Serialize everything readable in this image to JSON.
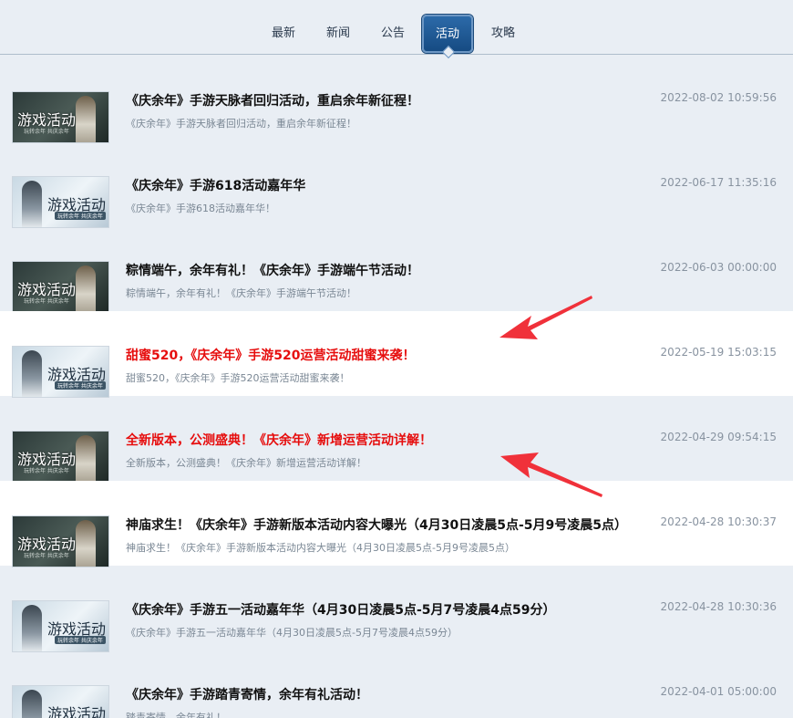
{
  "tabs": [
    {
      "label": "最新"
    },
    {
      "label": "新闻"
    },
    {
      "label": "公告"
    },
    {
      "label": "活动"
    },
    {
      "label": "攻略"
    }
  ],
  "active_tab": "活动",
  "thumbnail": {
    "title": "游戏活动",
    "subtitle": "玩转余年 共庆余年"
  },
  "articles": [
    {
      "title": "《庆余年》手游天脉者回归活动，重启余年新征程！",
      "summary": "《庆余年》手游天脉者回归活动，重启余年新征程！",
      "date": "2022-08-02 10:59:56",
      "highlight": false
    },
    {
      "title": "《庆余年》手游618活动嘉年华",
      "summary": "《庆余年》手游618活动嘉年华！",
      "date": "2022-06-17 11:35:16",
      "highlight": false
    },
    {
      "title": "粽情端午，余年有礼！《庆余年》手游端午节活动！",
      "summary": "粽情端午，余年有礼！《庆余年》手游端午节活动！",
      "date": "2022-06-03 00:00:00",
      "highlight": false
    },
    {
      "title": "甜蜜520，《庆余年》手游520运营活动甜蜜来袭！",
      "summary": "甜蜜520，《庆余年》手游520运营活动甜蜜来袭！",
      "date": "2022-05-19 15:03:15",
      "highlight": true
    },
    {
      "title": "全新版本，公测盛典！《庆余年》新增运营活动详解！",
      "summary": "全新版本，公测盛典！《庆余年》新增运营活动详解！",
      "date": "2022-04-29 09:54:15",
      "highlight": true
    },
    {
      "title": "神庙求生！《庆余年》手游新版本活动内容大曝光（4月30日凌晨5点-5月9号凌晨5点）",
      "summary": "神庙求生！《庆余年》手游新版本活动内容大曝光（4月30日凌晨5点-5月9号凌晨5点）",
      "date": "2022-04-28 10:30:37",
      "highlight": false
    },
    {
      "title": "《庆余年》手游五一活动嘉年华（4月30日凌晨5点-5月7号凌晨4点59分）",
      "summary": "《庆余年》手游五一活动嘉年华（4月30日凌晨5点-5月7号凌晨4点59分）",
      "date": "2022-04-28 10:30:36",
      "highlight": false
    },
    {
      "title": "《庆余年》手游踏青寄情，余年有礼活动！",
      "summary": "踏青寄情，余年有礼！",
      "date": "2022-04-01 05:00:00",
      "highlight": false
    }
  ],
  "colors": {
    "page_background": "#e9eef4",
    "row_white": "#ffffff",
    "highlight_title": "#e60d0d",
    "active_tab": "#1f5a95",
    "annotation_arrow": "#f0313a"
  }
}
